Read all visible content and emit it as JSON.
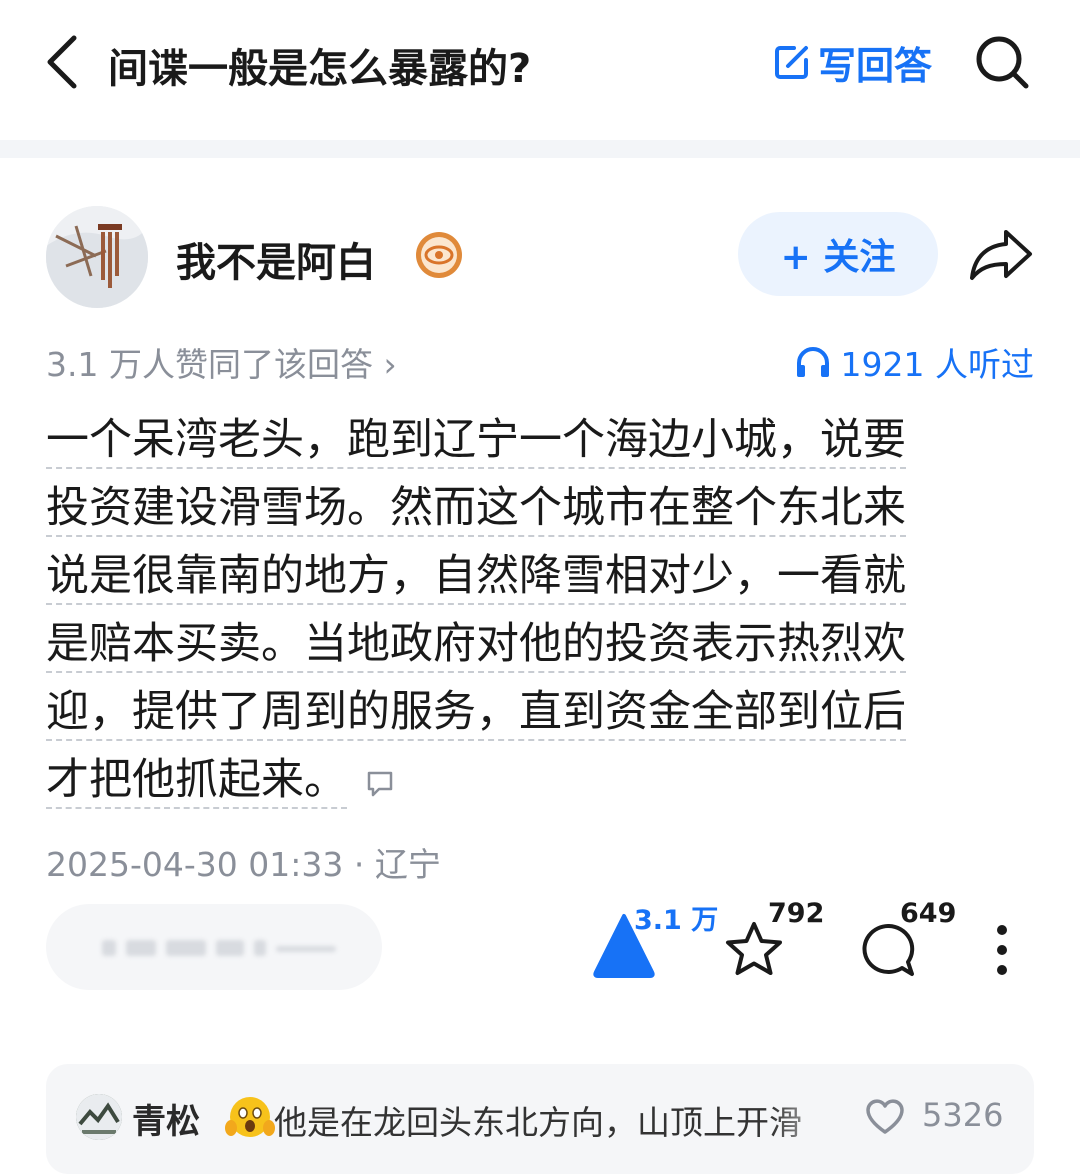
{
  "header": {
    "question_title": "间谍一般是怎么暴露的?",
    "write_answer_label": "写回答"
  },
  "author": {
    "name": "我不是阿白",
    "follow_label": "+ 关注"
  },
  "answer": {
    "agree_text": "3.1 万人赞同了该回答 ›",
    "listen_text": "1921 人听过",
    "content_lines": [
      "一个呆湾老头，跑到辽宁一个海边小城，说要",
      "投资建设滑雪场。然而这个城市在整个东北来",
      "说是很靠南的地方，自然降雪相对少，一看就",
      "是赔本买卖。当地政府对他的投资表示热烈欢",
      "迎，提供了周到的服务，直到资金全部到位后",
      "才把他抓起来。"
    ],
    "timestamp": "2025-04-30 01:33 · 辽宁"
  },
  "actions": {
    "vote_count": "3.1 万",
    "favorite_count": "792",
    "comment_count": "649"
  },
  "hot_comment": {
    "user": "青松",
    "text": "他是在龙回头东北方向，山顶上开滑",
    "likes": "5326"
  },
  "colors": {
    "accent": "#1772f6",
    "muted": "#8a8f99",
    "follow_bg": "#ebf3fe",
    "panel_bg": "#f5f6f8"
  }
}
